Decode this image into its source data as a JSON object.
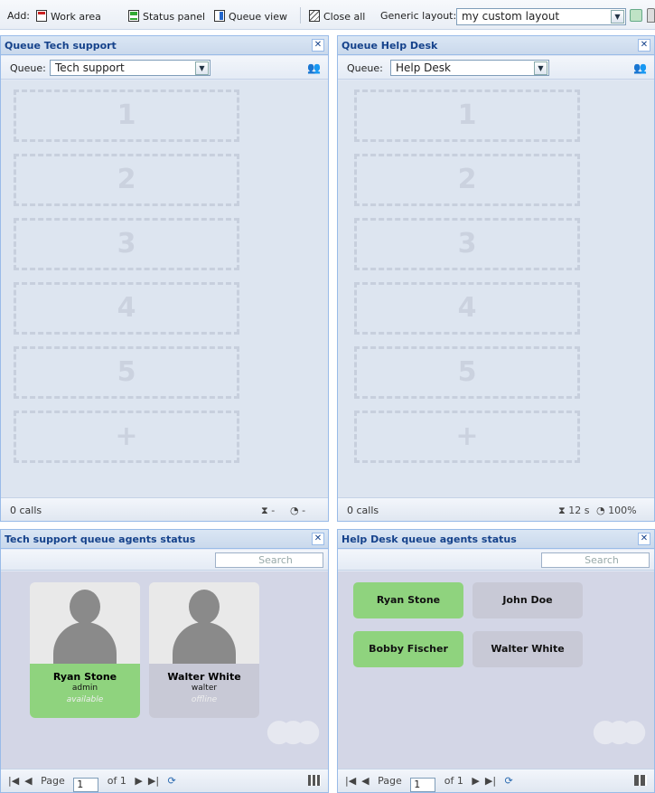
{
  "toolbar": {
    "add_label": "Add:",
    "work_area": "Work area",
    "status_panel": "Status panel",
    "queue_view": "Queue view",
    "close_all": "Close all",
    "layout_label": "Generic layout:",
    "layout_value": "my custom layout"
  },
  "queues": [
    {
      "title": "Queue Tech support",
      "queue_label": "Queue:",
      "queue_value": "Tech support",
      "slots": [
        "1",
        "2",
        "3",
        "4",
        "5",
        "+"
      ],
      "calls": "0 calls",
      "wait": "-",
      "service": "-"
    },
    {
      "title": "Queue Help Desk",
      "queue_label": "Queue:",
      "queue_value": "Help Desk",
      "slots": [
        "1",
        "2",
        "3",
        "4",
        "5",
        "+"
      ],
      "calls": "0 calls",
      "wait": "12 s",
      "service": "100%"
    }
  ],
  "agents_panels": [
    {
      "title": "Tech support queue agents status",
      "search_placeholder": "Search",
      "view": "cards",
      "agents": [
        {
          "name": "Ryan Stone",
          "username": "admin",
          "status": "available",
          "color": "#8fd37e"
        },
        {
          "name": "Walter White",
          "username": "walter",
          "status": "offline",
          "color": "#c8c9d6"
        }
      ],
      "page_label": "Page",
      "page": "1",
      "of": "of 1"
    },
    {
      "title": "Help Desk queue agents status",
      "search_placeholder": "Search",
      "view": "tiles",
      "agents": [
        {
          "name": "Ryan Stone",
          "color": "#8fd37e"
        },
        {
          "name": "John Doe",
          "color": "#c8c9d6"
        },
        {
          "name": "Bobby Fischer",
          "color": "#8fd37e"
        },
        {
          "name": "Walter White",
          "color": "#c8c9d6"
        }
      ],
      "page_label": "Page",
      "page": "1",
      "of": "of 1"
    }
  ]
}
